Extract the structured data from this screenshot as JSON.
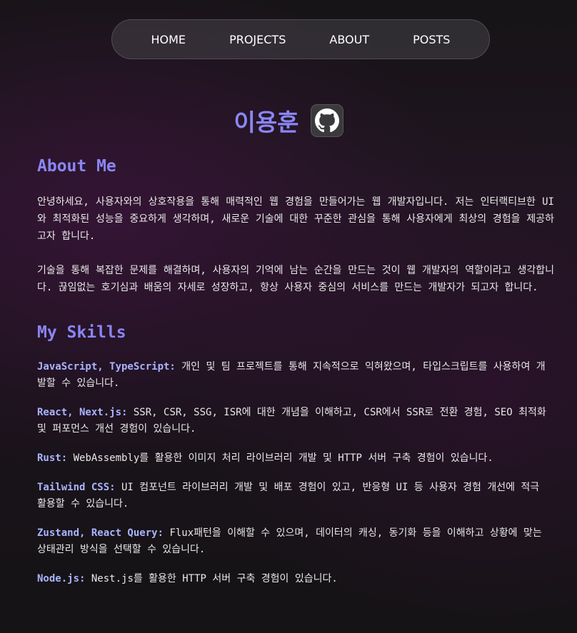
{
  "nav": {
    "items": [
      "HOME",
      "PROJECTS",
      "ABOUT",
      "POSTS"
    ]
  },
  "header": {
    "name": "이용훈",
    "github_icon": "github-icon"
  },
  "about": {
    "heading": "About Me",
    "paragraphs": [
      "안녕하세요, 사용자와의 상호작용을 통해 매력적인 웹 경험을 만들어가는 웹 개발자입니다. 저는 인터랙티브한 UI와 최적화된 성능을 중요하게 생각하며, 새로운 기술에 대한 꾸준한 관심을 통해 사용자에게 최상의 경험을 제공하고자 합니다.",
      "기술을 통해 복잡한 문제를 해결하며, 사용자의 기억에 남는 순간을 만드는 것이 웹 개발자의 역할이라고 생각합니다. 끊임없는 호기심과 배움의 자세로 성장하고, 항상 사용자 중심의 서비스를 만드는 개발자가 되고자 합니다."
    ]
  },
  "skills": {
    "heading": "My Skills",
    "items": [
      {
        "key": "JavaScript, TypeScript:",
        "text": " 개인 및 팀 프로젝트를 통해 지속적으로 익혀왔으며, 타입스크립트를 사용하여 개발할 수 있습니다."
      },
      {
        "key": "React, Next.js:",
        "text": " SSR, CSR, SSG, ISR에 대한 개념을 이해하고, CSR에서 SSR로 전환 경험, SEO 최적화 및 퍼포먼스 개선 경험이 있습니다."
      },
      {
        "key": "Rust:",
        "text": " WebAssembly를 활용한 이미지 처리 라이브러리 개발 및 HTTP 서버 구축 경험이 있습니다."
      },
      {
        "key": "Tailwind CSS:",
        "text": " UI 컴포넌트 라이브러리 개발 및 배포 경험이 있고, 반응형 UI 등 사용자 경험 개선에 적극 활용할 수 있습니다."
      },
      {
        "key": "Zustand, React Query:",
        "text": " Flux패턴을 이해할 수 있으며, 데이터의 캐싱, 동기화 등을 이해하고 상황에 맞는 상태관리 방식을 선택할 수 있습니다."
      },
      {
        "key": "Node.js:",
        "text": " Nest.js를 활용한 HTTP 서버 구축 경험이 있습니다."
      }
    ]
  },
  "colors": {
    "accent": "#8a86f5",
    "skill_key": "#a9b4ff"
  }
}
